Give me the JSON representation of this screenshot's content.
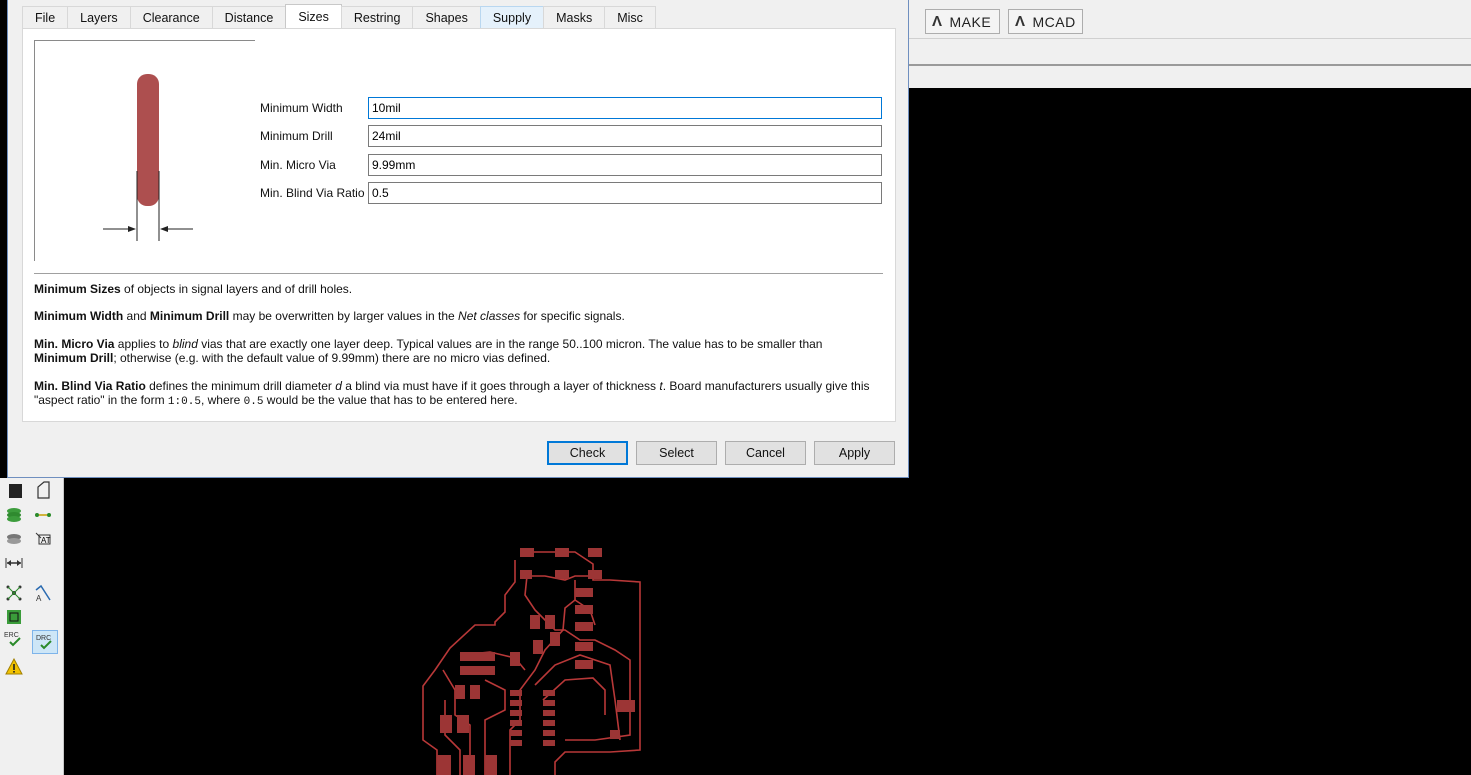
{
  "dialog": {
    "tabs": [
      {
        "label": "File"
      },
      {
        "label": "Layers"
      },
      {
        "label": "Clearance"
      },
      {
        "label": "Distance"
      },
      {
        "label": "Sizes"
      },
      {
        "label": "Restring"
      },
      {
        "label": "Shapes"
      },
      {
        "label": "Supply"
      },
      {
        "label": "Masks"
      },
      {
        "label": "Misc"
      }
    ],
    "active_tab": "Sizes",
    "fields": [
      {
        "label": "Minimum Width",
        "value": "10mil"
      },
      {
        "label": "Minimum Drill",
        "value": "24mil"
      },
      {
        "label": "Min. Micro Via",
        "value": "9.99mm"
      },
      {
        "label": "Min. Blind Via Ratio",
        "value": "0.5"
      }
    ],
    "help": {
      "p1_bold": "Minimum Sizes",
      "p1_rest": " of objects in signal layers and of drill holes.",
      "p2_bold1": "Minimum Width",
      "p2_and": " and ",
      "p2_bold2": "Minimum Drill",
      "p2_mid": " may be overwritten by larger values in the ",
      "p2_italic": "Net classes",
      "p2_end": " for specific signals.",
      "p3_bold1": "Min. Micro Via",
      "p3_a": " applies to ",
      "p3_italic": "blind",
      "p3_b": " vias that are exactly one layer deep. Typical values are in the range 50..100 micron. The value has to be smaller than",
      "p3_bold2": "Minimum Drill",
      "p3_c": "; otherwise (e.g. with the default value of 9.99mm) there are no micro vias defined.",
      "p4_bold": "Min. Blind Via Ratio",
      "p4_a": " defines the minimum drill diameter ",
      "p4_italic1": "d",
      "p4_b": " a blind via must have if it goes through a layer of thickness ",
      "p4_italic2": "t",
      "p4_c": ". Board manufacturers usually give this",
      "p4_d": "\"aspect ratio\" in the form ",
      "p4_mono1": "1:0.5",
      "p4_e": ", where ",
      "p4_mono2": "0.5",
      "p4_f": " would be the value that has to be entered here."
    },
    "buttons": {
      "check": "Check",
      "select": "Select",
      "cancel": "Cancel",
      "apply": "Apply"
    }
  },
  "toolbar": {
    "make_label": "MAKE",
    "mcad_label": "MCAD",
    "logo_glyph": "Λ"
  },
  "colors": {
    "copper": "#a84a4a",
    "trace": "#c03a3a",
    "focus": "#0078d7",
    "canvas": "#000000"
  },
  "left_panel": {
    "erc_label": "ERC",
    "drc_label": "DRC"
  }
}
